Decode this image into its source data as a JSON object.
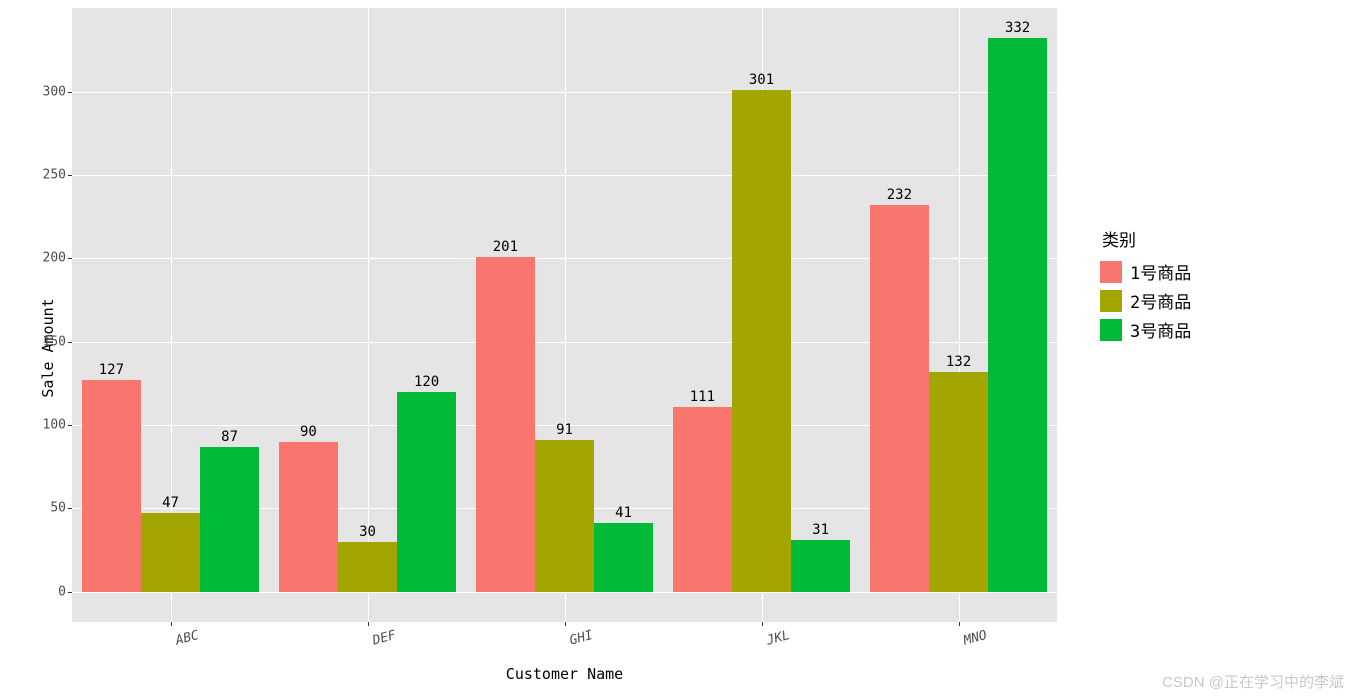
{
  "chart_data": {
    "type": "bar",
    "categories": [
      "ABC",
      "DEF",
      "GHI",
      "JKL",
      "MNO"
    ],
    "series": [
      {
        "name": "1号商品",
        "color": "#F8766D",
        "values": [
          127,
          90,
          201,
          111,
          232
        ]
      },
      {
        "name": "2号商品",
        "color": "#A3A500",
        "values": [
          47,
          30,
          91,
          301,
          132
        ]
      },
      {
        "name": "3号商品",
        "color": "#00BA38",
        "values": [
          87,
          120,
          41,
          31,
          332
        ]
      }
    ],
    "xlabel": "Customer Name",
    "ylabel": "Sale Amount",
    "ylim": [
      0,
      332
    ],
    "y_ticks": [
      0,
      50,
      100,
      150,
      200,
      250,
      300
    ],
    "legend_title": "类别"
  },
  "watermark": "CSDN @正在学习中的李斌"
}
